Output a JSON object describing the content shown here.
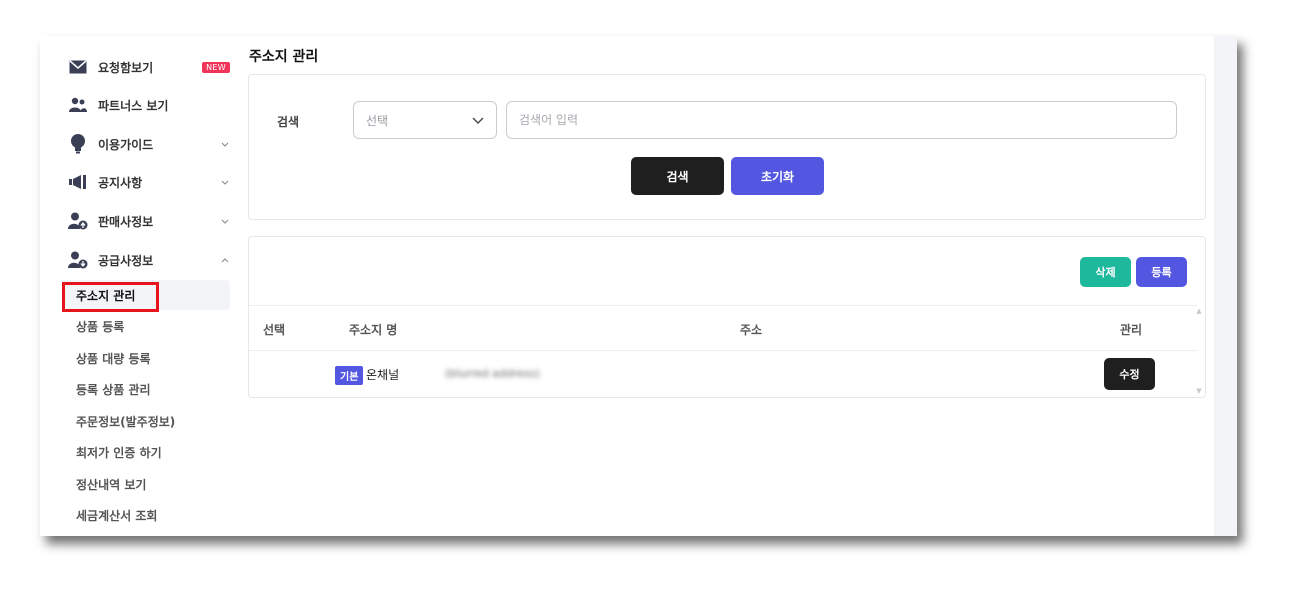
{
  "sidebar": {
    "items": [
      {
        "label": "요청함보기",
        "badge": "NEW",
        "icon": "mail-icon"
      },
      {
        "label": "파트너스 보기",
        "icon": "people-icon"
      },
      {
        "label": "이용가이드",
        "icon": "lightbulb-icon"
      },
      {
        "label": "공지사항",
        "icon": "megaphone-icon"
      },
      {
        "label": "판매사정보",
        "icon": "user-up-icon"
      },
      {
        "label": "공급사정보",
        "icon": "user-down-icon"
      }
    ],
    "subitems": [
      "주소지 관리",
      "상품 등록",
      "상품 대량 등록",
      "등록 상품 관리",
      "주문정보(발주정보)",
      "최저가 인증 하기",
      "정산내역 보기",
      "세금계산서 조회"
    ]
  },
  "page": {
    "title": "주소지 관리"
  },
  "search": {
    "label": "검색",
    "select_value": "선택",
    "placeholder": "검색어 입력",
    "search_button": "검색",
    "reset_button": "초기화"
  },
  "list": {
    "delete_button": "삭제",
    "register_button": "등록",
    "columns": [
      "선택",
      "주소지 명",
      "주소",
      "관리"
    ],
    "rows": [
      {
        "tag": "기본",
        "name": "온채널",
        "address": "(blurred address)",
        "action": "수정"
      }
    ]
  },
  "colors": {
    "accent": "#5256e0",
    "teal": "#1eb89d",
    "dark": "#1f1f1f",
    "badge": "#f0345a",
    "highlight": "#e8141b"
  }
}
